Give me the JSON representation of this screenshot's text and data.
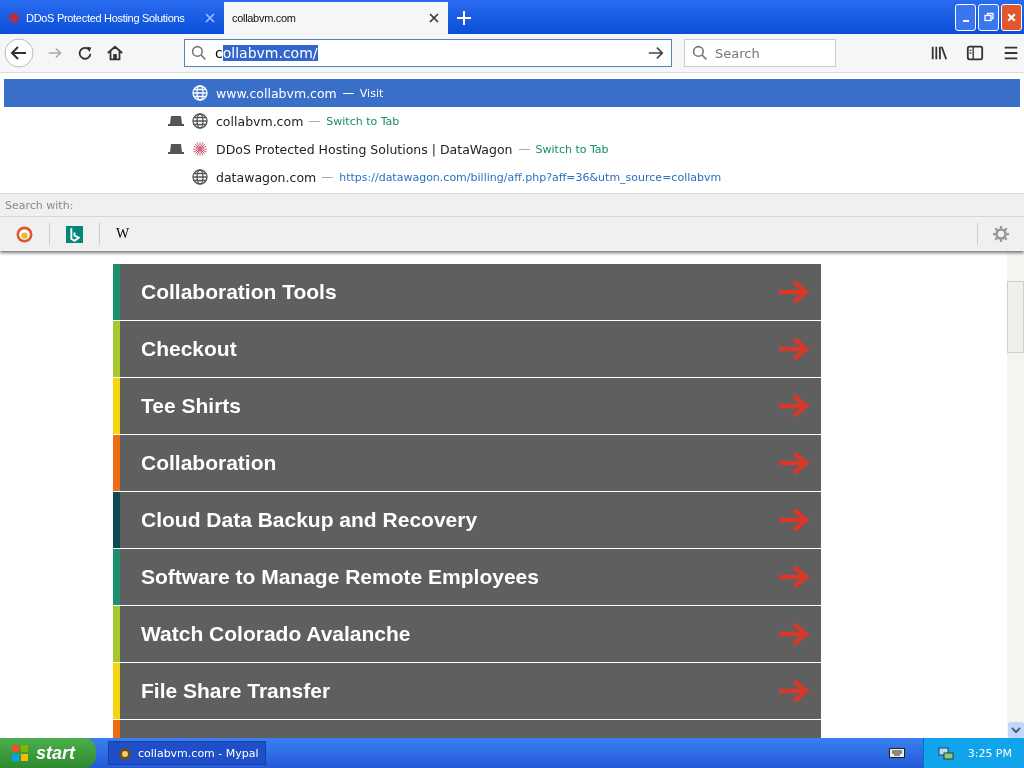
{
  "tabs": [
    {
      "title": "DDoS Protected Hosting Solutions",
      "selected": false,
      "kind": "ddos"
    },
    {
      "title": "collabvm.com",
      "selected": true,
      "kind": "blank"
    }
  ],
  "address_bar": {
    "typed": "c",
    "selected_text": "ollabvm.com/"
  },
  "search_field": {
    "placeholder": "Search"
  },
  "suggestions": [
    {
      "kind": "globe",
      "tab_open": false,
      "selected": true,
      "title": "www.collabvm.com",
      "action": "Visit"
    },
    {
      "kind": "globe",
      "tab_open": true,
      "selected": false,
      "title": "collabvm.com",
      "action": "Switch to Tab"
    },
    {
      "kind": "ddos",
      "tab_open": true,
      "selected": false,
      "title": "DDoS Protected Hosting Solutions | DataWagon",
      "action": "Switch to Tab"
    },
    {
      "kind": "globe",
      "tab_open": false,
      "selected": false,
      "title": "datawagon.com",
      "url": "https://datawagon.com/billing/aff.php?aff=36&utm_source=collabvm"
    }
  ],
  "search_with": {
    "label": "Search with:",
    "engines": [
      {
        "kind": "duck"
      },
      {
        "kind": "bing"
      },
      {
        "kind": "wiki",
        "glyph": "W"
      }
    ]
  },
  "links": [
    {
      "label": "Collaboration Tools",
      "color": "#1b8f6e"
    },
    {
      "label": "Checkout",
      "color": "#a6c82c"
    },
    {
      "label": "Tee Shirts",
      "color": "#f7d50c"
    },
    {
      "label": "Collaboration",
      "color": "#f06c14"
    },
    {
      "label": "Cloud Data Backup and Recovery",
      "color": "#0c4a52"
    },
    {
      "label": "Software to Manage Remote Employees",
      "color": "#1b8f6e"
    },
    {
      "label": "Watch Colorado Avalanche",
      "color": "#a6c82c"
    },
    {
      "label": "File Share Transfer",
      "color": "#f7d50c"
    },
    {
      "color": "#f06c14"
    }
  ],
  "taskbar": {
    "start": "start",
    "task": "collabvm.com - Mypal",
    "clock": "3:25 PM"
  }
}
